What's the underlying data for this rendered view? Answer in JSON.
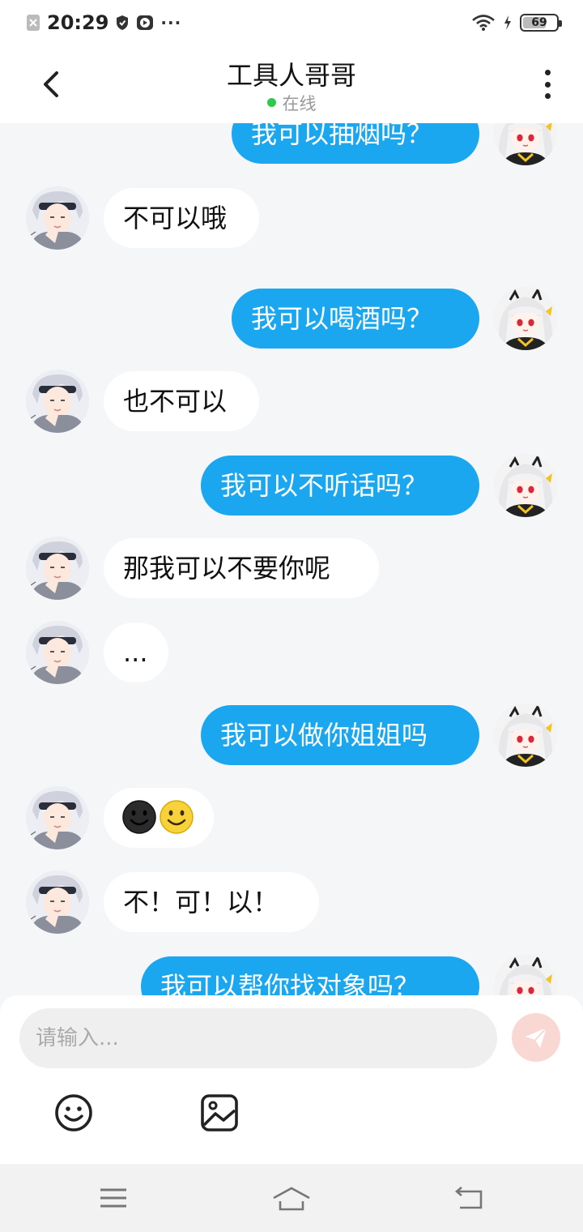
{
  "status_bar": {
    "time": "20:29",
    "more": "···",
    "battery": "69",
    "battery_level": 0.69
  },
  "header": {
    "title": "工具人哥哥",
    "status": "在线"
  },
  "messages": [
    {
      "from": "me",
      "text": "我可以抽烟吗？"
    },
    {
      "from": "contact",
      "text": "不可以哦"
    },
    {
      "from": "me",
      "text": "我可以喝酒吗？"
    },
    {
      "from": "contact",
      "text": "也不可以"
    },
    {
      "from": "me",
      "text": "我可以不听话吗？"
    },
    {
      "from": "contact",
      "text": "那我可以不要你呢"
    },
    {
      "from": "contact",
      "text": "..."
    },
    {
      "from": "me",
      "text": "我可以做你姐姐吗"
    },
    {
      "from": "contact",
      "emojis": [
        "dark-smile-face",
        "yellow-smile-face"
      ]
    },
    {
      "from": "contact",
      "text": "不！可！以！"
    },
    {
      "from": "me",
      "text": "我可以帮你找对象吗？"
    }
  ],
  "composer": {
    "placeholder": "请输入..."
  },
  "icons": {
    "back": "chevron-left-icon",
    "more": "more-vertical-icon",
    "send": "send-icon",
    "emoji": "emoji-icon",
    "image": "image-icon",
    "nav_menu": "menu-icon",
    "nav_home": "home-icon",
    "nav_back": "back-icon"
  },
  "colors": {
    "outgoing_bubble": "#1aa7f0",
    "incoming_bubble": "#ffffff",
    "online": "#2ec94a",
    "send_button": "#f9d8d4",
    "background": "#f4f6f8"
  }
}
